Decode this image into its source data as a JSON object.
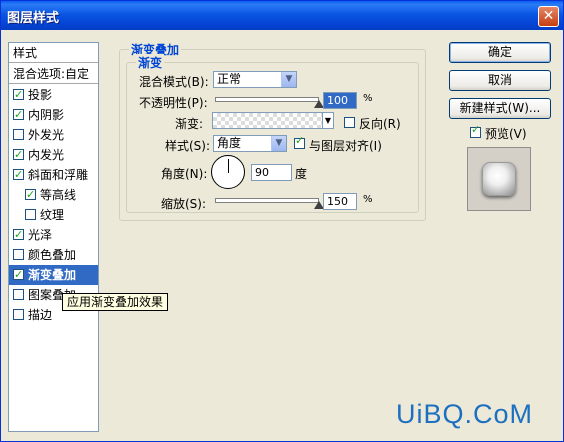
{
  "window": {
    "title": "图层样式",
    "close_glyph": "✕"
  },
  "sidebar": {
    "header": "样式",
    "blend_options": "混合选项:自定",
    "items": [
      {
        "label": "投影",
        "checked": true,
        "indent": false,
        "selected": false
      },
      {
        "label": "内阴影",
        "checked": true,
        "indent": false,
        "selected": false
      },
      {
        "label": "外发光",
        "checked": false,
        "indent": false,
        "selected": false
      },
      {
        "label": "内发光",
        "checked": true,
        "indent": false,
        "selected": false
      },
      {
        "label": "斜面和浮雕",
        "checked": true,
        "indent": false,
        "selected": false
      },
      {
        "label": "等高线",
        "checked": true,
        "indent": true,
        "selected": false
      },
      {
        "label": "纹理",
        "checked": false,
        "indent": true,
        "selected": false
      },
      {
        "label": "光泽",
        "checked": true,
        "indent": false,
        "selected": false
      },
      {
        "label": "颜色叠加",
        "checked": false,
        "indent": false,
        "selected": false
      },
      {
        "label": "渐变叠加",
        "checked": true,
        "indent": false,
        "selected": true
      },
      {
        "label": "图案叠加",
        "checked": false,
        "indent": false,
        "selected": false
      },
      {
        "label": "描边",
        "checked": false,
        "indent": false,
        "selected": false
      }
    ],
    "tooltip": "应用渐变叠加效果"
  },
  "panel": {
    "group_title": "渐变叠加",
    "inner_title": "渐变",
    "blend_mode_label": "混合模式(B):",
    "blend_mode_value": "正常",
    "opacity_label": "不透明性(P):",
    "opacity_value": "100",
    "opacity_unit": "%",
    "opacity_level": 1.0,
    "gradient_label": "渐变:",
    "reverse_label": "反向(R)",
    "reverse_checked": false,
    "style_label": "样式(S):",
    "style_value": "角度",
    "align_label": "与图层对齐(I)",
    "align_checked": true,
    "angle_label": "角度(N):",
    "angle_value": "90",
    "angle_unit": "度",
    "scale_label": "缩放(S):",
    "scale_value": "150",
    "scale_unit": "%",
    "scale_level": 1.0
  },
  "buttons": {
    "ok": "确定",
    "cancel": "取消",
    "new_style": "新建样式(W)...",
    "preview_label": "预览(V)",
    "preview_checked": true
  },
  "watermark": "UiBQ.CoM"
}
